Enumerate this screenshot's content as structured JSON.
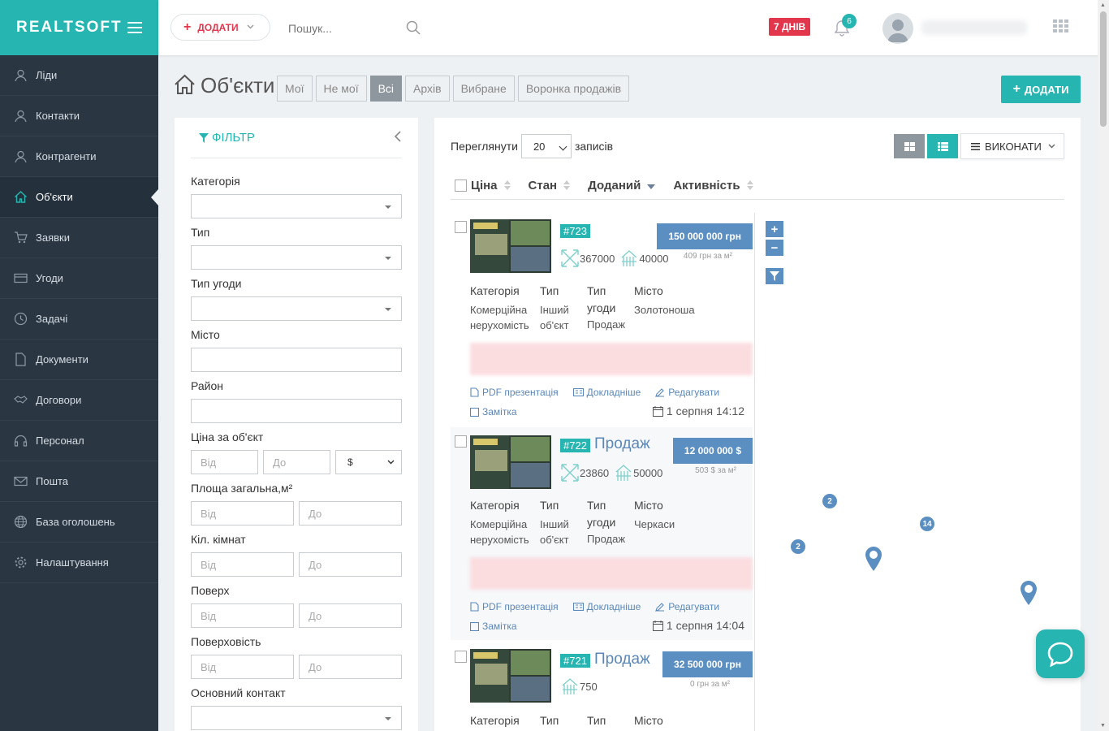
{
  "app": {
    "logo": "REALTSOFT"
  },
  "colors": {
    "accent": "#26b5b0",
    "sidebar": "#2b3643",
    "danger": "#e2364d",
    "price": "#5b8ec1"
  },
  "sidebar": {
    "items": [
      {
        "label": "Ліди",
        "icon": "user-icon"
      },
      {
        "label": "Контакти",
        "icon": "user-icon"
      },
      {
        "label": "Контрагенти",
        "icon": "user-icon"
      },
      {
        "label": "Об'єкти",
        "icon": "home-icon",
        "active": true
      },
      {
        "label": "Заявки",
        "icon": "cart-icon"
      },
      {
        "label": "Угоди",
        "icon": "card-icon"
      },
      {
        "label": "Задачі",
        "icon": "clock-icon"
      },
      {
        "label": "Документи",
        "icon": "document-icon"
      },
      {
        "label": "Договори",
        "icon": "handshake-icon"
      },
      {
        "label": "Персонал",
        "icon": "headset-icon"
      },
      {
        "label": "Пошта",
        "icon": "mail-icon"
      },
      {
        "label": "База оголошень",
        "icon": "globe-icon"
      },
      {
        "label": "Налаштування",
        "icon": "gear-icon"
      }
    ]
  },
  "topbar": {
    "add_label": "ДОДАТИ",
    "search_placeholder": "Пошук...",
    "trial_badge": "7 ДНІВ",
    "notifications_count": "6"
  },
  "page": {
    "title": "Об'єкти",
    "tabs": [
      {
        "label": "Мої",
        "active": false
      },
      {
        "label": "Не мої",
        "active": false
      },
      {
        "label": "Всі",
        "active": true
      },
      {
        "label": "Архів",
        "active": false
      },
      {
        "label": "Вибране",
        "active": false
      },
      {
        "label": "Воронка продажів",
        "active": false
      }
    ],
    "add_label": "ДОДАТИ"
  },
  "filter": {
    "title": "ФІЛЬТР",
    "category": "Категорія",
    "type": "Тип",
    "deal_type": "Тип угоди",
    "city": "Місто",
    "district": "Район",
    "price_per_object": "Ціна за об'єкт",
    "from": "Від",
    "to": "До",
    "currency": "$",
    "total_area": "Площа загальна,м²",
    "rooms": "Кіл. кімнат",
    "floor": "Поверх",
    "floors_total": "Поверховість",
    "main_contact": "Основний контакт"
  },
  "list": {
    "view_label": "Переглянути",
    "per_page": "20",
    "records_label": "записів",
    "execute_label": "ВИКОНАТИ",
    "sort": {
      "price": "Ціна",
      "state": "Стан",
      "added": "Доданий",
      "activity": "Активність"
    },
    "attr_headers": {
      "category": "Категорія",
      "type": "Тип",
      "deal_type_1": "Тип",
      "deal_type_2": "угоди",
      "city": "Місто"
    },
    "links": {
      "pdf": "PDF презентація",
      "details": "Докладніше",
      "edit": "Редагувати",
      "note": "Замітка"
    },
    "items": [
      {
        "id": "#723",
        "deal": "",
        "area": "367000",
        "land": "40000",
        "price": "150 000 000 грн",
        "per_m2": "409 грн за м²",
        "category_1": "Комерційна",
        "category_2": "нерухомість",
        "type_1": "Інший",
        "type_2": "об'єкт",
        "deal_value": "Продаж",
        "city": "Золотоноша",
        "date": "1 серпня 14:12"
      },
      {
        "id": "#722",
        "deal": "Продаж",
        "area": "23860",
        "land": "50000",
        "price": "12 000 000 $",
        "per_m2": "503 $ за м²",
        "category_1": "Комерційна",
        "category_2": "нерухомість",
        "type_1": "Інший",
        "type_2": "об'єкт",
        "deal_value": "Продаж",
        "city": "Черкаси",
        "date": "1 серпня 14:04"
      },
      {
        "id": "#721",
        "deal": "Продаж",
        "area": "",
        "land": "750",
        "price": "32 500 000 грн",
        "per_m2": "0 грн за м²"
      }
    ]
  },
  "map": {
    "zoom_in": "+",
    "zoom_out": "−",
    "clusters": [
      "2",
      "14",
      "2"
    ]
  }
}
